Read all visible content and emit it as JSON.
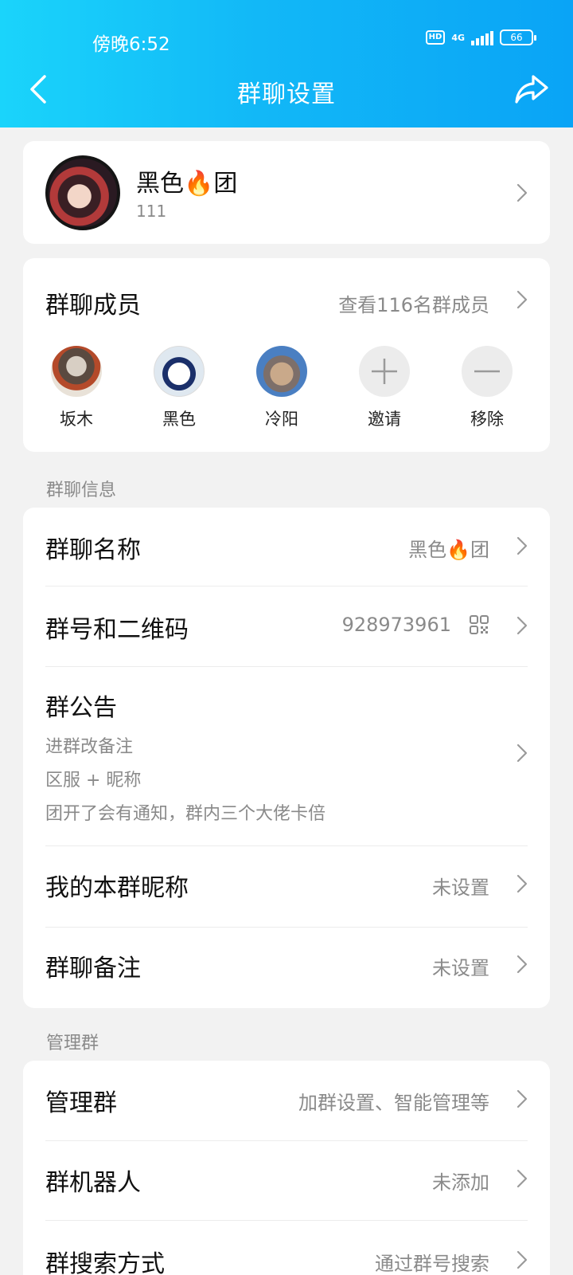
{
  "status_bar": {
    "time": "傍晚6:52",
    "hd": "HD",
    "network": "4G",
    "battery": "66"
  },
  "header": {
    "title": "群聊设置",
    "colors": {
      "gradient_start": "#1ad4fb",
      "gradient_end": "#0aa4f6"
    }
  },
  "group": {
    "name": "黑色🔥团",
    "subtitle": "111"
  },
  "members": {
    "title": "群聊成员",
    "view_all": "查看116名群成员",
    "list": [
      {
        "name": "坂木"
      },
      {
        "name": "黑色"
      },
      {
        "name": "冷阳"
      }
    ],
    "invite_label": "邀请",
    "remove_label": "移除"
  },
  "info_section": {
    "label": "群聊信息",
    "name_row": {
      "title": "群聊名称",
      "value": "黑色🔥团"
    },
    "number_row": {
      "title": "群号和二维码",
      "value": "928973961"
    },
    "notice_row": {
      "title": "群公告",
      "lines": [
        "进群改备注",
        "区服 + 昵称",
        "团开了会有通知，群内三个大佬卡倍"
      ]
    },
    "nickname_row": {
      "title": "我的本群昵称",
      "value": "未设置"
    },
    "remark_row": {
      "title": "群聊备注",
      "value": "未设置"
    }
  },
  "manage_section": {
    "label": "管理群",
    "manage_row": {
      "title": "管理群",
      "value": "加群设置、智能管理等"
    },
    "robot_row": {
      "title": "群机器人",
      "value": "未添加"
    },
    "search_row": {
      "title": "群搜索方式",
      "value": "通过群号搜索"
    }
  },
  "icons": {
    "back": "back-arrow-icon",
    "share": "share-icon",
    "chevron": "chevron-right-icon",
    "qr": "qr-code-icon",
    "plus": "plus-icon",
    "minus": "minus-icon"
  }
}
